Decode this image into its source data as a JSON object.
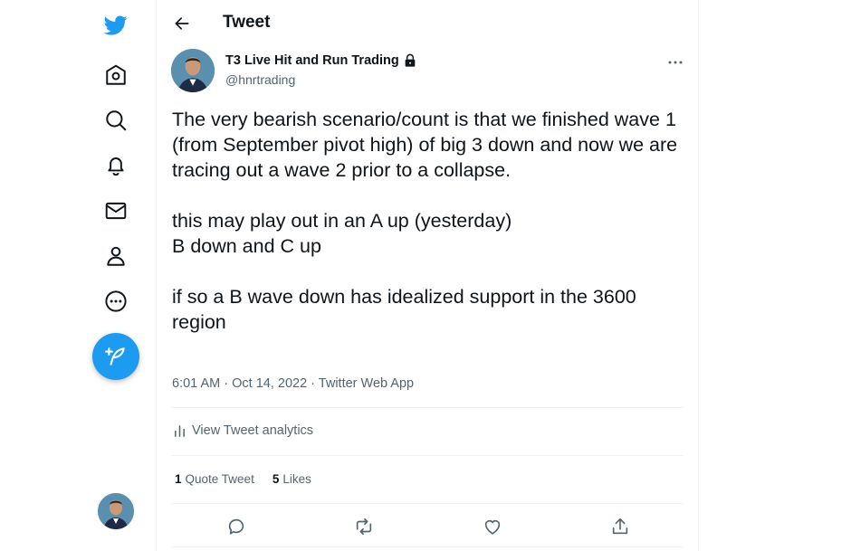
{
  "icons": {
    "logo": "twitter-bird-icon",
    "home": "home-icon",
    "explore": "search-icon",
    "notifications": "bell-icon",
    "messages": "envelope-icon",
    "profile": "person-icon",
    "more": "more-circle-icon",
    "compose": "feather-plus-icon"
  },
  "colors": {
    "accent": "#1d9bf0",
    "text": "#0f1419",
    "muted": "#536471",
    "border": "#eff3f4"
  },
  "header": {
    "title": "Tweet"
  },
  "tweet": {
    "author_name": "T3 Live Hit and Run Trading",
    "handle": "@hnrtrading",
    "text": "The very bearish scenario/count is that we finished wave 1 (from September pivot high) of big 3 down and now we are tracing out a wave 2 prior to a collapse.\n\nthis may play out in an A up (yesterday)\nB down and C up\n\nif so a B wave down has idealized support in the 3600 region",
    "time": "6:01 AM",
    "date": "Oct 14, 2022",
    "separator": "·",
    "source": "Twitter Web App",
    "analytics_label": "View Tweet analytics",
    "quote_count": "1",
    "quote_label": "Quote Tweet",
    "like_count": "5",
    "like_label": "Likes"
  }
}
